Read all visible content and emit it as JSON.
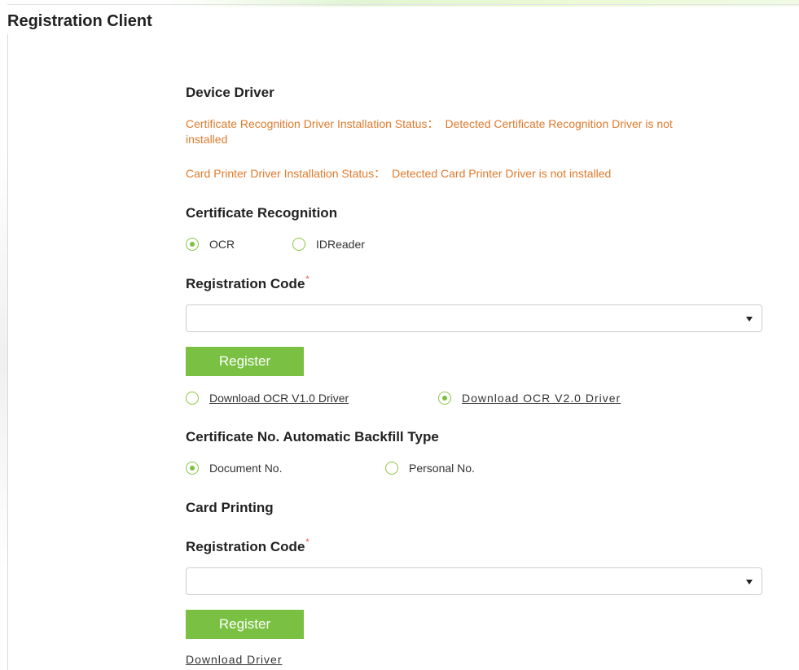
{
  "page": {
    "title": "Registration Client"
  },
  "device_driver": {
    "heading": "Device Driver",
    "cert_status": {
      "label": "Certificate Recognition Driver Installation Status：",
      "value": "Detected Certificate Recognition Driver is not",
      "value_wrap": "installed"
    },
    "printer_status": {
      "label": "Card Printer Driver Installation Status：",
      "value": "Detected Card Printer Driver is not installed"
    }
  },
  "certificate_recognition": {
    "heading": "Certificate Recognition",
    "options": [
      {
        "label": "OCR",
        "selected": true
      },
      {
        "label": "IDReader",
        "selected": false
      }
    ],
    "registration_code": {
      "label": "Registration Code",
      "required_mark": "*",
      "value": ""
    },
    "register_button": "Register",
    "downloads": [
      {
        "label": "Download OCR V1.0 Driver",
        "selected": false
      },
      {
        "label": "Download OCR V2.0 Driver",
        "selected": true
      }
    ]
  },
  "backfill": {
    "heading": "Certificate No. Automatic Backfill Type",
    "options": [
      {
        "label": "Document No.",
        "selected": true
      },
      {
        "label": "Personal No.",
        "selected": false
      }
    ]
  },
  "card_printing": {
    "heading": "Card Printing",
    "registration_code": {
      "label": "Registration Code",
      "required_mark": "*",
      "value": ""
    },
    "register_button": "Register",
    "download_link": "Download Driver"
  },
  "colors": {
    "accent_green": "#7ac143",
    "status_orange": "#e07a2c",
    "required_red": "#e84a3c"
  }
}
